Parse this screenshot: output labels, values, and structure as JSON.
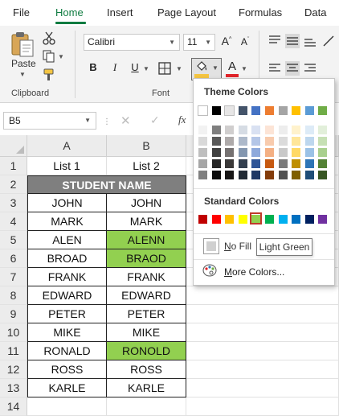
{
  "ribbon": {
    "tabs": [
      {
        "label": "File",
        "active": false
      },
      {
        "label": "Home",
        "active": true
      },
      {
        "label": "Insert",
        "active": false
      },
      {
        "label": "Page Layout",
        "active": false
      },
      {
        "label": "Formulas",
        "active": false
      },
      {
        "label": "Data",
        "active": false
      }
    ],
    "clipboard": {
      "paste_label": "Paste",
      "group_label": "Clipboard"
    },
    "font": {
      "group_label": "Font",
      "font_name": "Calibri",
      "font_size": "11",
      "bold": "B",
      "italic": "I",
      "underline": "U",
      "fill_color": "#f4c542",
      "font_color": "#e0242a"
    }
  },
  "formula_bar": {
    "name_box": "B5",
    "fx": "fx",
    "content": ""
  },
  "grid": {
    "columns": [
      "A",
      "B"
    ],
    "rows": [
      {
        "num": "1",
        "a": "List 1",
        "b": "List 2",
        "a_fill": "",
        "b_fill": ""
      },
      {
        "num": "2",
        "merged": "STUDENT NAME"
      },
      {
        "num": "3",
        "a": "JOHN",
        "b": "JOHN",
        "b_fill": ""
      },
      {
        "num": "4",
        "a": "MARK",
        "b": "MARK",
        "b_fill": ""
      },
      {
        "num": "5",
        "a": "ALEN",
        "b": "ALENN",
        "b_fill": "#92d050"
      },
      {
        "num": "6",
        "a": "BROAD",
        "b": "BRAOD",
        "b_fill": "#92d050"
      },
      {
        "num": "7",
        "a": "FRANK",
        "b": "FRANK",
        "b_fill": ""
      },
      {
        "num": "8",
        "a": "EDWARD",
        "b": "EDWARD",
        "b_fill": ""
      },
      {
        "num": "9",
        "a": "PETER",
        "b": "PETER",
        "b_fill": ""
      },
      {
        "num": "10",
        "a": "MIKE",
        "b": "MIKE",
        "b_fill": ""
      },
      {
        "num": "11",
        "a": "RONALD",
        "b": "RONOLD",
        "b_fill": "#92d050"
      },
      {
        "num": "12",
        "a": "ROSS",
        "b": "ROSS",
        "b_fill": ""
      },
      {
        "num": "13",
        "a": "KARLE",
        "b": "KARLE",
        "b_fill": ""
      },
      {
        "num": "14",
        "a": "",
        "b": "",
        "b_fill": ""
      }
    ]
  },
  "color_picker": {
    "theme_title": "Theme Colors",
    "standard_title": "Standard Colors",
    "no_fill_label": "No Fill",
    "more_colors_label": "More Colors...",
    "tooltip": "Light Green",
    "theme_top": [
      "#ffffff",
      "#000000",
      "#e7e6e6",
      "#44546a",
      "#4472c4",
      "#ed7d31",
      "#a5a5a5",
      "#ffc000",
      "#5b9bd5",
      "#70ad47"
    ],
    "theme_shades": [
      [
        "#f2f2f2",
        "#7f7f7f",
        "#d0cece",
        "#d6dce4",
        "#d9e1f2",
        "#fce4d6",
        "#ededed",
        "#fff2cc",
        "#ddebf7",
        "#e2efda"
      ],
      [
        "#d9d9d9",
        "#595959",
        "#aeaaaa",
        "#adb9ca",
        "#b4c6e7",
        "#f8cbad",
        "#dbdbdb",
        "#ffe699",
        "#bdd7ee",
        "#c6e0b4"
      ],
      [
        "#bfbfbf",
        "#404040",
        "#757171",
        "#8497b0",
        "#8ea9db",
        "#f4b084",
        "#c9c9c9",
        "#ffd966",
        "#9bc2e6",
        "#a9d08e"
      ],
      [
        "#a6a6a6",
        "#262626",
        "#3a3838",
        "#333f4f",
        "#2f5597",
        "#c65911",
        "#7b7b7b",
        "#bf8f00",
        "#2e75b6",
        "#548235"
      ],
      [
        "#808080",
        "#0d0d0d",
        "#171616",
        "#222b35",
        "#1f3864",
        "#833c0b",
        "#525252",
        "#7f6000",
        "#1f4e78",
        "#375623"
      ]
    ],
    "standard": [
      "#c00000",
      "#ff0000",
      "#ffc000",
      "#ffff00",
      "#92d050",
      "#00b050",
      "#00b0f0",
      "#0070c0",
      "#002060",
      "#7030a0"
    ]
  }
}
